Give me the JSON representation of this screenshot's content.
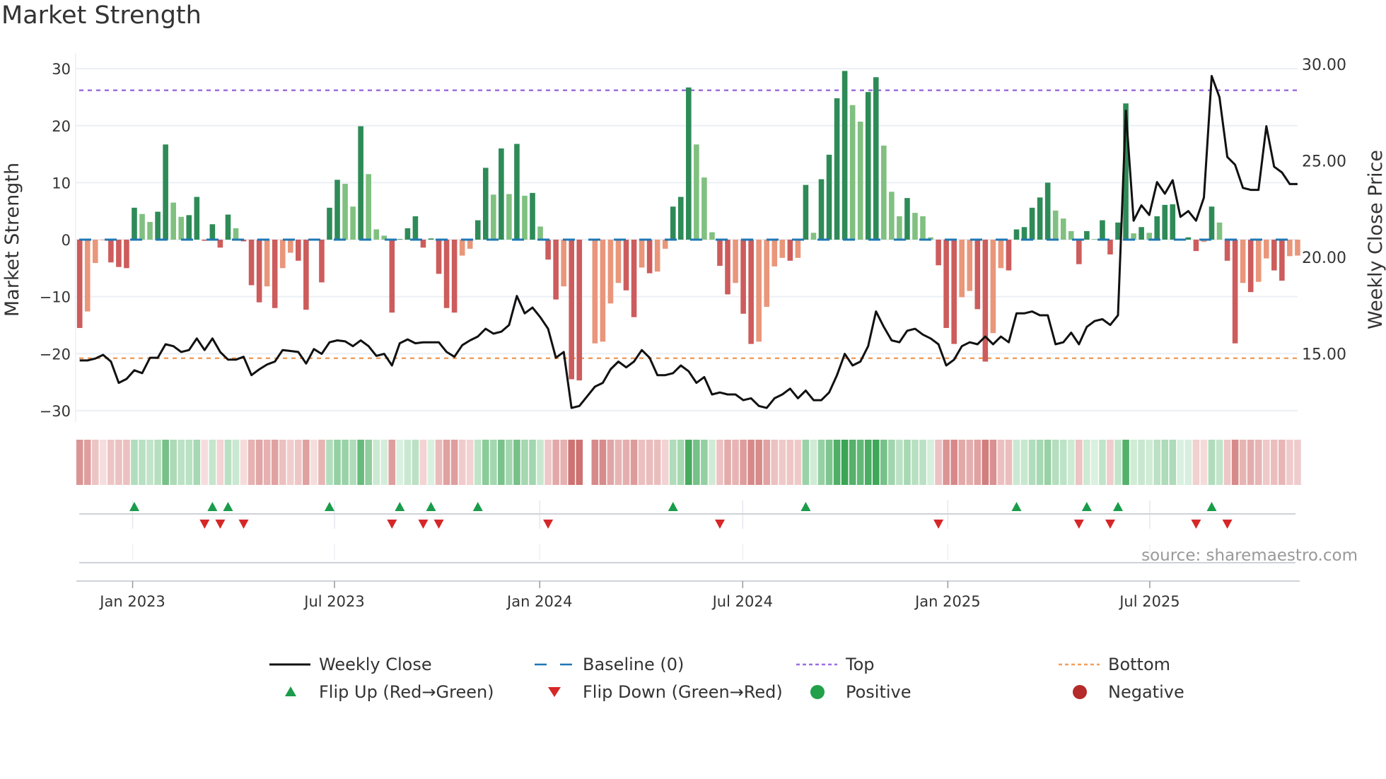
{
  "title": "Market Strength",
  "source": "source: sharemaestro.com",
  "colors": {
    "bar_pos_strong": "#2e8b57",
    "bar_pos_weak": "#80c080",
    "bar_neg_strong": "#cd5c5c",
    "bar_neg_weak": "#e9967a",
    "close_line": "#111111",
    "baseline": "#1f77b4",
    "top": "#9d6fe0",
    "bottom": "#f0a060",
    "flip_up": "#1a9c4a",
    "flip_down": "#d62728",
    "positive": "#22a04a",
    "negative": "#b52a2a"
  },
  "legend": [
    {
      "label": "Weekly Close",
      "kind": "line"
    },
    {
      "label": "Baseline (0)",
      "kind": "baseline"
    },
    {
      "label": "Top",
      "kind": "top"
    },
    {
      "label": "Bottom",
      "kind": "bottom"
    },
    {
      "label": "Flip Up (Red→Green)",
      "kind": "flip_up"
    },
    {
      "label": "Flip Down (Green→Red)",
      "kind": "flip_down"
    },
    {
      "label": "Positive",
      "kind": "positive"
    },
    {
      "label": "Negative",
      "kind": "negative"
    }
  ],
  "chart_data": {
    "type": "bar",
    "title": "Market Strength",
    "xlabel": "",
    "ylabel": "Market Strength",
    "ylabel_right": "Weekly Close Price",
    "ylim": [
      -32,
      32
    ],
    "ylim_right": [
      11.47,
      30.37
    ],
    "yticks": [
      30,
      20,
      10,
      0,
      -10,
      -20,
      -30
    ],
    "yticklabels": [
      "30",
      "20",
      "10",
      "0",
      "−10",
      "−20",
      "−30"
    ],
    "yticks_right": [
      30,
      25,
      20,
      15
    ],
    "yticklabels_right": [
      "30.00",
      "25.00",
      "20.00",
      "15.00"
    ],
    "grid": true,
    "legend_position": "bottom",
    "x_unit": "week index",
    "xticks": [
      {
        "label": "Jan 2023",
        "week": 6.78
      },
      {
        "label": "Jul 2023",
        "week": 32.64
      },
      {
        "label": "Jan 2024",
        "week": 58.93
      },
      {
        "label": "Jul 2024",
        "week": 84.93
      },
      {
        "label": "Jan 2025",
        "week": 111.2
      },
      {
        "label": "Jul 2025",
        "week": 137.07
      }
    ],
    "top_level": 26.2,
    "bottom_level": -20.8,
    "baseline": 0,
    "series": [
      {
        "name": "Market Strength",
        "type": "bar",
        "values": [
          -15.5,
          -12.6,
          -4.1,
          -0.1,
          -4,
          -4.8,
          -5,
          5.6,
          4.5,
          3.1,
          4.9,
          16.7,
          6.5,
          4.0,
          4.3,
          7.5,
          -0.2,
          2.7,
          -1.4,
          4.4,
          2.0,
          -0.3,
          -8,
          -11,
          -8.2,
          -12,
          -5,
          -2.3,
          -3.7,
          -12.3,
          -0.1,
          -7.5,
          5.6,
          10.5,
          9.8,
          5.8,
          19.9,
          11.5,
          1.8,
          0.7,
          -12.8,
          0.1,
          2,
          4.1,
          -1.4,
          0.2,
          -6,
          -12,
          -12.8,
          -2.8,
          -1.6,
          3.4,
          12.6,
          7.9,
          16,
          8,
          16.8,
          7.7,
          8.2,
          2.3,
          -3.5,
          -10.5,
          -8.2,
          -24.5,
          -24.7,
          null,
          -18.2,
          -17.9,
          -11.2,
          -7.6,
          -8.9,
          -13.6,
          -4.9,
          -5.9,
          -5.6,
          -1.6,
          5.8,
          7.5,
          26.7,
          16.7,
          10.9,
          1.3,
          -4.6,
          -9.6,
          -7.6,
          -13,
          -18.3,
          -17.9,
          -11.8,
          -4.7,
          -3.2,
          -3.7,
          -3.2,
          9.6,
          1.2,
          10.6,
          14.9,
          24.8,
          29.6,
          23.6,
          20.7,
          25.9,
          28.5,
          16.5,
          8.4,
          4.1,
          7.3,
          4.7,
          4.1,
          0.4,
          -4.5,
          -15.5,
          -18.3,
          -10.1,
          -9,
          -12.2,
          -21.4,
          -16.4,
          -5,
          -5.4,
          1.8,
          2.2,
          5.6,
          7.4,
          10,
          5.1,
          3.7,
          1.5,
          -4.3,
          1.5,
          0.1,
          3.4,
          -2.6,
          3,
          23.9,
          1.1,
          2.2,
          1.2,
          4.1,
          6.1,
          6.2,
          0.1,
          0.4,
          -2,
          -0.4,
          5.8,
          3,
          -3.7,
          -18.2,
          -7.6,
          -9.2,
          -7.4,
          -3.3,
          -5.4,
          -7.2,
          -2.9,
          -2.8
        ]
      },
      {
        "name": "Weekly Close",
        "type": "line",
        "axis": "right",
        "values": [
          14.66,
          14.66,
          14.76,
          14.95,
          14.6,
          13.5,
          13.7,
          14.15,
          14.0,
          14.8,
          14.8,
          15.5,
          15.4,
          15.1,
          15.2,
          15.8,
          15.2,
          15.8,
          15.1,
          14.7,
          14.7,
          14.85,
          13.9,
          14.2,
          14.45,
          14.6,
          15.2,
          15.15,
          15.1,
          14.5,
          15.25,
          15.0,
          15.6,
          15.7,
          15.65,
          15.4,
          15.7,
          15.4,
          14.9,
          15.0,
          14.4,
          15.55,
          15.75,
          15.55,
          15.6,
          15.6,
          15.6,
          15.1,
          14.85,
          15.45,
          15.7,
          15.9,
          16.3,
          16.05,
          16.15,
          16.5,
          18.0,
          17.1,
          17.4,
          16.9,
          16.3,
          14.8,
          15.1,
          12.2,
          12.3,
          12.8,
          13.3,
          13.5,
          14.2,
          14.6,
          14.3,
          14.6,
          15.2,
          14.8,
          13.9,
          13.9,
          14.0,
          14.4,
          14.1,
          13.5,
          13.8,
          12.9,
          13.0,
          12.9,
          12.9,
          12.6,
          12.7,
          12.3,
          12.2,
          12.7,
          12.9,
          13.2,
          12.7,
          13.1,
          12.6,
          12.6,
          13.0,
          13.9,
          15.0,
          14.4,
          14.6,
          15.4,
          17.2,
          16.4,
          15.7,
          15.6,
          16.2,
          16.3,
          16.0,
          15.8,
          15.5,
          14.4,
          14.7,
          15.4,
          15.6,
          15.5,
          15.9,
          15.5,
          15.9,
          15.6,
          17.1,
          17.1,
          17.2,
          17.0,
          17.0,
          15.5,
          15.6,
          16.1,
          15.5,
          16.4,
          16.7,
          16.8,
          16.5,
          17.0,
          27.6,
          21.9,
          22.7,
          22.2,
          23.9,
          23.3,
          24.0,
          22.1,
          22.4,
          21.9,
          23.1,
          29.4,
          28.3,
          25.2,
          24.8,
          23.6,
          23.5,
          23.5,
          26.8,
          24.7,
          24.4,
          23.8,
          23.8
        ]
      }
    ],
    "flip_up_weeks": [
      7,
      17,
      19,
      32,
      41,
      45,
      51,
      76,
      93,
      120,
      129,
      133,
      145
    ],
    "flip_down_weeks": [
      16,
      18,
      21,
      40,
      44,
      46,
      60,
      82,
      110,
      128,
      132,
      143,
      147
    ]
  }
}
